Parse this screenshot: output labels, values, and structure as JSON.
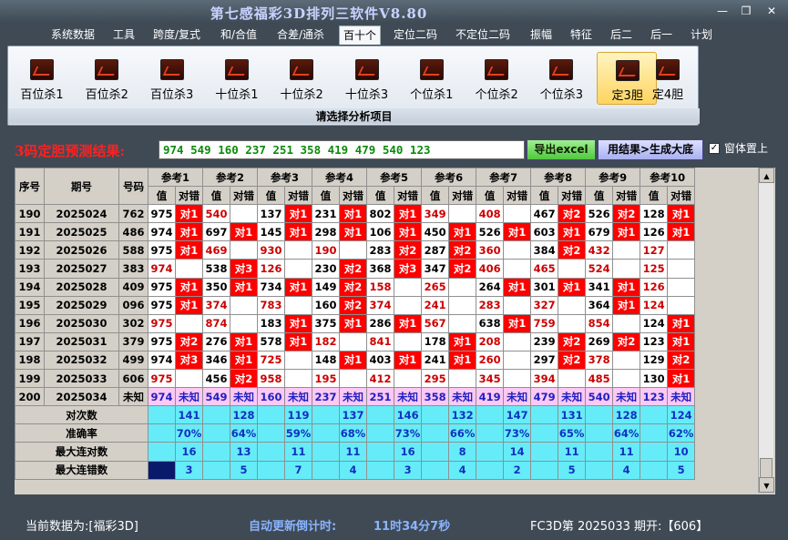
{
  "window": {
    "title": "第七感福彩3D排列三软件V8.80",
    "min_icon": "minimize-icon",
    "max_icon": "restore-icon",
    "close_icon": "close-icon",
    "min": "—",
    "max": "❐",
    "close": "✕"
  },
  "menu": [
    "系统数据",
    "工具",
    "跨度/复式",
    "和/合值",
    "合差/通杀",
    "百十个",
    "定位二码",
    "不定位二码",
    "振幅",
    "特征",
    "后二",
    "后一",
    "计划"
  ],
  "menu_active": "百十个",
  "ribbon": {
    "buttons": [
      "百位杀1",
      "百位杀2",
      "百位杀3",
      "十位杀1",
      "十位杀2",
      "十位杀3",
      "个位杀1",
      "个位杀2",
      "个位杀3",
      "定3胆",
      "定4胆"
    ],
    "selected": "定3胆",
    "caption": "请选择分析项目"
  },
  "result": {
    "label": "3码定胆预测结果:",
    "value": "974 549 160 237 251 358 419 479 540 123",
    "export_button": "导出excel",
    "generate_button": "用结果>生成大底",
    "checkbox_label": "窗体置上",
    "checkbox_mark": "✓"
  },
  "table": {
    "headers": {
      "seq": "序号",
      "period": "期号",
      "number": "号码",
      "refs": [
        "参考1",
        "参考2",
        "参考3",
        "参考4",
        "参考5",
        "参考6",
        "参考7",
        "参考8",
        "参考9",
        "参考10"
      ],
      "val": "值",
      "judge": "对错"
    },
    "rows": [
      {
        "seq": "190",
        "period": "2025024",
        "num": "762",
        "cells": [
          [
            "975",
            "对1"
          ],
          [
            "540",
            ""
          ],
          [
            "137",
            "对1"
          ],
          [
            "231",
            "对1"
          ],
          [
            "802",
            "对1"
          ],
          [
            "349",
            ""
          ],
          [
            "408",
            ""
          ],
          [
            "467",
            "对2"
          ],
          [
            "526",
            "对2"
          ],
          [
            "128",
            "对1"
          ]
        ]
      },
      {
        "seq": "191",
        "period": "2025025",
        "num": "486",
        "cells": [
          [
            "974",
            "对1"
          ],
          [
            "697",
            "对1"
          ],
          [
            "145",
            "对1"
          ],
          [
            "298",
            "对1"
          ],
          [
            "106",
            "对1"
          ],
          [
            "450",
            "对1"
          ],
          [
            "526",
            "对1"
          ],
          [
            "603",
            "对1"
          ],
          [
            "679",
            "对1"
          ],
          [
            "126",
            "对1"
          ]
        ]
      },
      {
        "seq": "192",
        "period": "2025026",
        "num": "588",
        "cells": [
          [
            "975",
            "对1"
          ],
          [
            "469",
            ""
          ],
          [
            "930",
            ""
          ],
          [
            "190",
            ""
          ],
          [
            "283",
            "对2"
          ],
          [
            "287",
            "对2"
          ],
          [
            "360",
            ""
          ],
          [
            "384",
            "对2"
          ],
          [
            "432",
            ""
          ],
          [
            "127",
            ""
          ]
        ]
      },
      {
        "seq": "193",
        "period": "2025027",
        "num": "383",
        "cells": [
          [
            "974",
            ""
          ],
          [
            "538",
            "对3"
          ],
          [
            "126",
            ""
          ],
          [
            "230",
            "对2"
          ],
          [
            "368",
            "对3"
          ],
          [
            "347",
            "对2"
          ],
          [
            "406",
            ""
          ],
          [
            "465",
            ""
          ],
          [
            "524",
            ""
          ],
          [
            "125",
            ""
          ]
        ]
      },
      {
        "seq": "194",
        "period": "2025028",
        "num": "409",
        "cells": [
          [
            "975",
            "对1"
          ],
          [
            "350",
            "对1"
          ],
          [
            "734",
            "对1"
          ],
          [
            "149",
            "对2"
          ],
          [
            "158",
            ""
          ],
          [
            "265",
            ""
          ],
          [
            "264",
            "对1"
          ],
          [
            "301",
            "对1"
          ],
          [
            "341",
            "对1"
          ],
          [
            "126",
            ""
          ]
        ]
      },
      {
        "seq": "195",
        "period": "2025029",
        "num": "096",
        "cells": [
          [
            "975",
            "对1"
          ],
          [
            "374",
            ""
          ],
          [
            "783",
            ""
          ],
          [
            "160",
            "对2"
          ],
          [
            "374",
            ""
          ],
          [
            "241",
            ""
          ],
          [
            "283",
            ""
          ],
          [
            "327",
            ""
          ],
          [
            "364",
            "对1"
          ],
          [
            "124",
            ""
          ]
        ]
      },
      {
        "seq": "196",
        "period": "2025030",
        "num": "302",
        "cells": [
          [
            "975",
            ""
          ],
          [
            "874",
            ""
          ],
          [
            "183",
            "对1"
          ],
          [
            "375",
            "对1"
          ],
          [
            "286",
            "对1"
          ],
          [
            "567",
            ""
          ],
          [
            "638",
            "对1"
          ],
          [
            "759",
            ""
          ],
          [
            "854",
            ""
          ],
          [
            "124",
            "对1"
          ]
        ]
      },
      {
        "seq": "197",
        "period": "2025031",
        "num": "379",
        "cells": [
          [
            "975",
            "对2"
          ],
          [
            "276",
            "对1"
          ],
          [
            "578",
            "对1"
          ],
          [
            "182",
            ""
          ],
          [
            "841",
            ""
          ],
          [
            "178",
            "对1"
          ],
          [
            "208",
            ""
          ],
          [
            "239",
            "对2"
          ],
          [
            "269",
            "对2"
          ],
          [
            "123",
            "对1"
          ]
        ]
      },
      {
        "seq": "198",
        "period": "2025032",
        "num": "499",
        "cells": [
          [
            "974",
            "对3"
          ],
          [
            "346",
            "对1"
          ],
          [
            "725",
            ""
          ],
          [
            "148",
            "对1"
          ],
          [
            "403",
            "对1"
          ],
          [
            "241",
            "对1"
          ],
          [
            "260",
            ""
          ],
          [
            "297",
            "对2"
          ],
          [
            "378",
            ""
          ],
          [
            "129",
            "对2"
          ]
        ]
      },
      {
        "seq": "199",
        "period": "2025033",
        "num": "606",
        "cells": [
          [
            "975",
            ""
          ],
          [
            "456",
            "对2"
          ],
          [
            "958",
            ""
          ],
          [
            "195",
            ""
          ],
          [
            "412",
            ""
          ],
          [
            "295",
            ""
          ],
          [
            "345",
            ""
          ],
          [
            "394",
            ""
          ],
          [
            "485",
            ""
          ],
          [
            "130",
            "对1"
          ]
        ]
      }
    ],
    "last_row": {
      "seq": "200",
      "period": "2025034",
      "num": "未知",
      "vals": [
        "974",
        "549",
        "160",
        "237",
        "251",
        "358",
        "419",
        "479",
        "540",
        "123"
      ],
      "judge": "未知"
    },
    "stats": [
      {
        "label": "对次数",
        "values": [
          "141",
          "128",
          "119",
          "137",
          "146",
          "132",
          "147",
          "131",
          "128",
          "124"
        ]
      },
      {
        "label": "准确率",
        "values": [
          "70%",
          "64%",
          "59%",
          "68%",
          "73%",
          "66%",
          "73%",
          "65%",
          "64%",
          "62%"
        ]
      },
      {
        "label": "最大连对数",
        "values": [
          "16",
          "13",
          "11",
          "11",
          "16",
          "8",
          "14",
          "11",
          "11",
          "10"
        ]
      },
      {
        "label": "最大连错数",
        "values": [
          "3",
          "5",
          "7",
          "4",
          "3",
          "4",
          "2",
          "5",
          "4",
          "5"
        ]
      }
    ]
  },
  "scroll": {
    "up": "▲",
    "down": "▼"
  },
  "status": {
    "current_data": "当前数据为:[福彩3D]",
    "countdown_label": "自动更新倒计时:",
    "countdown": "11时34分7秒",
    "latest": "FC3D第 2025033 期开:【606】"
  }
}
